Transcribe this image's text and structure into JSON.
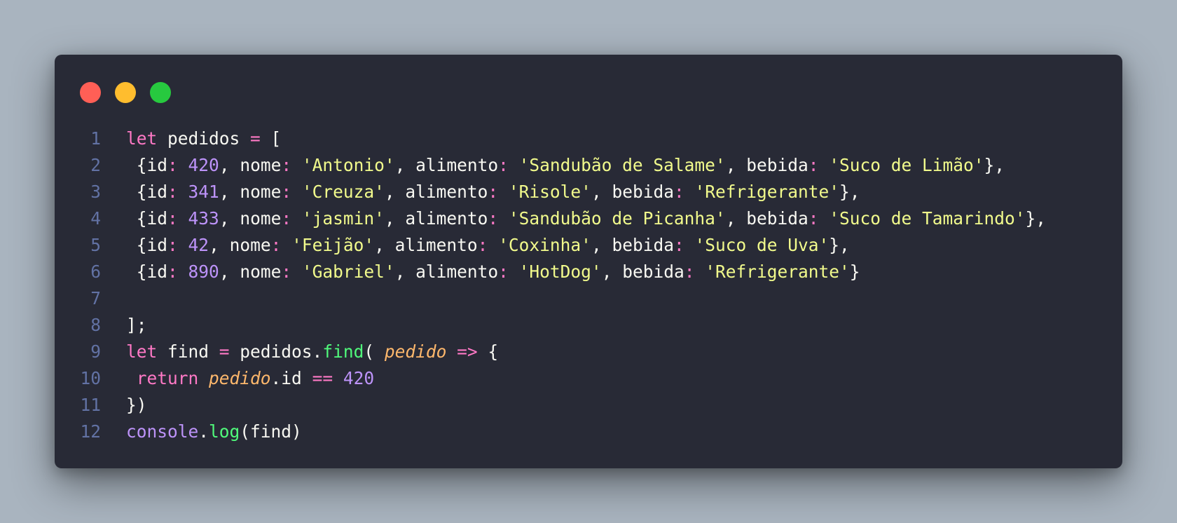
{
  "window": {
    "controls": [
      {
        "name": "close",
        "color": "#ff5f56"
      },
      {
        "name": "minimize",
        "color": "#ffbd2e"
      },
      {
        "name": "maximize",
        "color": "#27c93f"
      }
    ]
  },
  "theme": {
    "background": "#282a36",
    "line_number": "#6272a4",
    "keyword": "#ff79c6",
    "number": "#bd93f9",
    "string": "#f1fa8c",
    "function": "#50fa7b",
    "parameter": "#ffb86c",
    "text": "#f8f8f2"
  },
  "code": {
    "lines": [
      {
        "n": "1",
        "tokens": [
          {
            "t": "let",
            "c": "kw"
          },
          {
            "t": " pedidos ",
            "c": "id"
          },
          {
            "t": "=",
            "c": "op"
          },
          {
            "t": " [",
            "c": "punc"
          }
        ]
      },
      {
        "n": "2",
        "tokens": [
          {
            "t": " {id",
            "c": "id"
          },
          {
            "t": ":",
            "c": "op"
          },
          {
            "t": " ",
            "c": "punc"
          },
          {
            "t": "420",
            "c": "num"
          },
          {
            "t": ", nome",
            "c": "id"
          },
          {
            "t": ":",
            "c": "op"
          },
          {
            "t": " ",
            "c": "punc"
          },
          {
            "t": "'Antonio'",
            "c": "str"
          },
          {
            "t": ", alimento",
            "c": "id"
          },
          {
            "t": ":",
            "c": "op"
          },
          {
            "t": " ",
            "c": "punc"
          },
          {
            "t": "'Sandubão de Salame'",
            "c": "str"
          },
          {
            "t": ", bebida",
            "c": "id"
          },
          {
            "t": ":",
            "c": "op"
          },
          {
            "t": " ",
            "c": "punc"
          },
          {
            "t": "'Suco de Limão'",
            "c": "str"
          },
          {
            "t": "},",
            "c": "punc"
          }
        ]
      },
      {
        "n": "3",
        "tokens": [
          {
            "t": " {id",
            "c": "id"
          },
          {
            "t": ":",
            "c": "op"
          },
          {
            "t": " ",
            "c": "punc"
          },
          {
            "t": "341",
            "c": "num"
          },
          {
            "t": ", nome",
            "c": "id"
          },
          {
            "t": ":",
            "c": "op"
          },
          {
            "t": " ",
            "c": "punc"
          },
          {
            "t": "'Creuza'",
            "c": "str"
          },
          {
            "t": ", alimento",
            "c": "id"
          },
          {
            "t": ":",
            "c": "op"
          },
          {
            "t": " ",
            "c": "punc"
          },
          {
            "t": "'Risole'",
            "c": "str"
          },
          {
            "t": ", bebida",
            "c": "id"
          },
          {
            "t": ":",
            "c": "op"
          },
          {
            "t": " ",
            "c": "punc"
          },
          {
            "t": "'Refrigerante'",
            "c": "str"
          },
          {
            "t": "},",
            "c": "punc"
          }
        ]
      },
      {
        "n": "4",
        "tokens": [
          {
            "t": " {id",
            "c": "id"
          },
          {
            "t": ":",
            "c": "op"
          },
          {
            "t": " ",
            "c": "punc"
          },
          {
            "t": "433",
            "c": "num"
          },
          {
            "t": ", nome",
            "c": "id"
          },
          {
            "t": ":",
            "c": "op"
          },
          {
            "t": " ",
            "c": "punc"
          },
          {
            "t": "'jasmin'",
            "c": "str"
          },
          {
            "t": ", alimento",
            "c": "id"
          },
          {
            "t": ":",
            "c": "op"
          },
          {
            "t": " ",
            "c": "punc"
          },
          {
            "t": "'Sandubão de Picanha'",
            "c": "str"
          },
          {
            "t": ", bebida",
            "c": "id"
          },
          {
            "t": ":",
            "c": "op"
          },
          {
            "t": " ",
            "c": "punc"
          },
          {
            "t": "'Suco de Tamarindo'",
            "c": "str"
          },
          {
            "t": "},",
            "c": "punc"
          }
        ]
      },
      {
        "n": "5",
        "tokens": [
          {
            "t": " {id",
            "c": "id"
          },
          {
            "t": ":",
            "c": "op"
          },
          {
            "t": " ",
            "c": "punc"
          },
          {
            "t": "42",
            "c": "num"
          },
          {
            "t": ", nome",
            "c": "id"
          },
          {
            "t": ":",
            "c": "op"
          },
          {
            "t": " ",
            "c": "punc"
          },
          {
            "t": "'Feijão'",
            "c": "str"
          },
          {
            "t": ", alimento",
            "c": "id"
          },
          {
            "t": ":",
            "c": "op"
          },
          {
            "t": " ",
            "c": "punc"
          },
          {
            "t": "'Coxinha'",
            "c": "str"
          },
          {
            "t": ", bebida",
            "c": "id"
          },
          {
            "t": ":",
            "c": "op"
          },
          {
            "t": " ",
            "c": "punc"
          },
          {
            "t": "'Suco de Uva'",
            "c": "str"
          },
          {
            "t": "},",
            "c": "punc"
          }
        ]
      },
      {
        "n": "6",
        "tokens": [
          {
            "t": " {id",
            "c": "id"
          },
          {
            "t": ":",
            "c": "op"
          },
          {
            "t": " ",
            "c": "punc"
          },
          {
            "t": "890",
            "c": "num"
          },
          {
            "t": ", nome",
            "c": "id"
          },
          {
            "t": ":",
            "c": "op"
          },
          {
            "t": " ",
            "c": "punc"
          },
          {
            "t": "'Gabriel'",
            "c": "str"
          },
          {
            "t": ", alimento",
            "c": "id"
          },
          {
            "t": ":",
            "c": "op"
          },
          {
            "t": " ",
            "c": "punc"
          },
          {
            "t": "'HotDog'",
            "c": "str"
          },
          {
            "t": ", bebida",
            "c": "id"
          },
          {
            "t": ":",
            "c": "op"
          },
          {
            "t": " ",
            "c": "punc"
          },
          {
            "t": "'Refrigerante'",
            "c": "str"
          },
          {
            "t": "}",
            "c": "punc"
          }
        ]
      },
      {
        "n": "7",
        "tokens": []
      },
      {
        "n": "8",
        "tokens": [
          {
            "t": "];",
            "c": "punc"
          }
        ]
      },
      {
        "n": "9",
        "tokens": [
          {
            "t": "let",
            "c": "kw"
          },
          {
            "t": " find ",
            "c": "id"
          },
          {
            "t": "=",
            "c": "op"
          },
          {
            "t": " pedidos.",
            "c": "id"
          },
          {
            "t": "find",
            "c": "fn"
          },
          {
            "t": "( ",
            "c": "punc"
          },
          {
            "t": "pedido",
            "c": "param"
          },
          {
            "t": " ",
            "c": "punc"
          },
          {
            "t": "=>",
            "c": "op"
          },
          {
            "t": " {",
            "c": "punc"
          }
        ]
      },
      {
        "n": "10",
        "tokens": [
          {
            "t": " return",
            "c": "kw"
          },
          {
            "t": " ",
            "c": "punc"
          },
          {
            "t": "pedido",
            "c": "param"
          },
          {
            "t": ".id ",
            "c": "id"
          },
          {
            "t": "==",
            "c": "op"
          },
          {
            "t": " ",
            "c": "punc"
          },
          {
            "t": "420",
            "c": "num"
          }
        ]
      },
      {
        "n": "11",
        "tokens": [
          {
            "t": "})",
            "c": "punc"
          }
        ]
      },
      {
        "n": "12",
        "tokens": [
          {
            "t": "console",
            "c": "obj"
          },
          {
            "t": ".",
            "c": "punc"
          },
          {
            "t": "log",
            "c": "fn"
          },
          {
            "t": "(find)",
            "c": "punc"
          }
        ]
      }
    ]
  }
}
